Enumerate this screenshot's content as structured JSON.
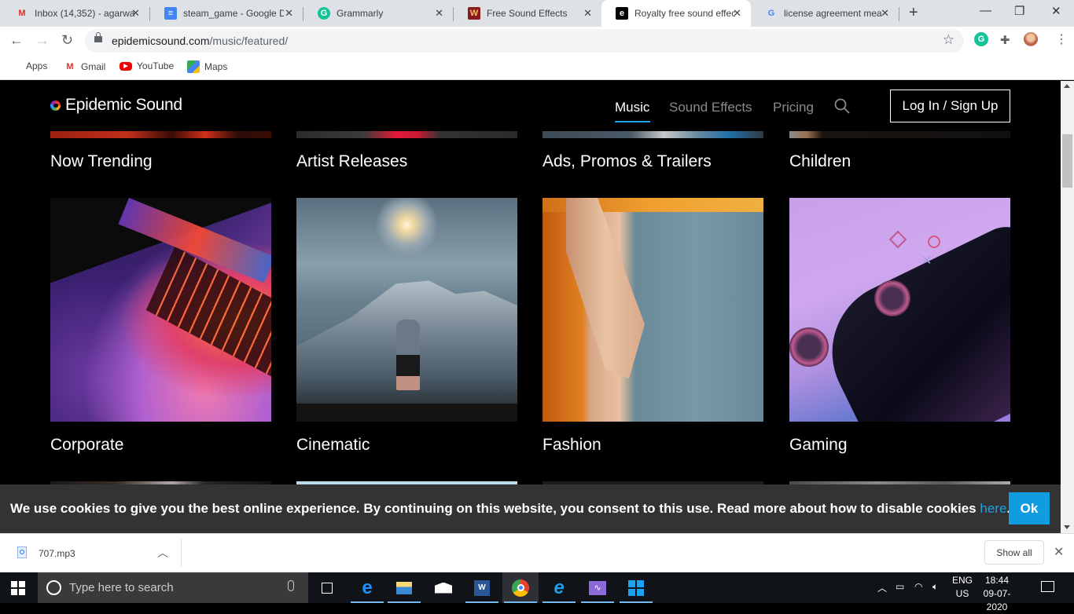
{
  "browser": {
    "tabs": [
      {
        "title": "Inbox (14,352) - agarwa",
        "icon": "gmail-icon",
        "fav_text": "M",
        "fav_color": "#d93025",
        "active": false
      },
      {
        "title": "steam_game - Google D",
        "icon": "google-docs-icon",
        "fav_text": "≡",
        "fav_color": "#4285f4",
        "active": false
      },
      {
        "title": "Grammarly",
        "icon": "grammarly-icon",
        "fav_text": "G",
        "fav_color": "#15c39a",
        "active": false
      },
      {
        "title": "Free Sound Effects",
        "icon": "free-sound-effects-icon",
        "fav_text": "W",
        "fav_color": "#8b1a1a",
        "active": false
      },
      {
        "title": "Royalty free sound effec",
        "icon": "epidemic-sound-icon",
        "fav_text": "e",
        "fav_color": "#000000",
        "active": true
      },
      {
        "title": "license agreement mea",
        "icon": "google-icon",
        "fav_text": "G",
        "fav_color": "#4285f4",
        "active": false
      }
    ],
    "new_tab_label": "+",
    "window_controls": {
      "minimize": "—",
      "restore": "❐",
      "close": "✕"
    },
    "url_host": "epidemicsound.com",
    "url_path": "/music/featured/",
    "bookmarks": [
      {
        "label": "Apps",
        "icon": "apps-grid-icon"
      },
      {
        "label": "Gmail",
        "icon": "gmail-icon"
      },
      {
        "label": "YouTube",
        "icon": "youtube-icon"
      },
      {
        "label": "Maps",
        "icon": "maps-icon"
      }
    ]
  },
  "site": {
    "logo_text": "Epidemic Sound",
    "nav": [
      {
        "label": "Music",
        "active": true
      },
      {
        "label": "Sound Effects",
        "active": false
      },
      {
        "label": "Pricing",
        "active": false
      }
    ],
    "login_label": "Log In / Sign Up",
    "accent_color": "#1da1e5",
    "top_row": [
      "Now Trending",
      "Artist Releases",
      "Ads, Promos & Trailers",
      "Children"
    ],
    "middle_row": [
      "Corporate",
      "Cinematic",
      "Fashion",
      "Gaming"
    ]
  },
  "cookie_banner": {
    "text": "We use cookies to give you the best online experience. By continuing on this website, you consent to this use. Read more about how to disable cookies ",
    "link": "here",
    "period": ".",
    "ok_label": "Ok"
  },
  "downloads": {
    "file": "707.mp3",
    "show_all_label": "Show all"
  },
  "taskbar": {
    "search_placeholder": "Type here to search",
    "lang_top": "ENG",
    "lang_bottom": "US",
    "time": "18:44",
    "date": "09-07-2020"
  }
}
